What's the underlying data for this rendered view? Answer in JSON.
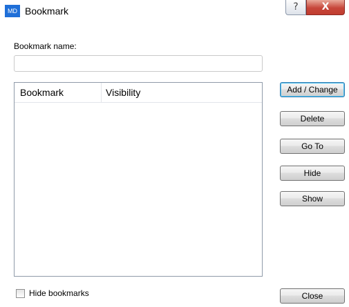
{
  "window": {
    "app_icon_text": "MD",
    "title": "Bookmark",
    "help_glyph": "?",
    "close_glyph": "X"
  },
  "form": {
    "name_label": "Bookmark name:",
    "name_value": "",
    "name_placeholder": ""
  },
  "list": {
    "columns": [
      "Bookmark",
      "Visibility"
    ],
    "rows": []
  },
  "buttons": {
    "add_change": "Add / Change",
    "delete": "Delete",
    "go_to": "Go To",
    "hide": "Hide",
    "show": "Show",
    "close": "Close"
  },
  "options": {
    "hide_bookmarks_label": "Hide bookmarks",
    "hide_bookmarks_checked": false
  },
  "colors": {
    "app_icon": "#1f6fd8",
    "close_button": "#c7463a",
    "default_button_border": "#3c7fb1"
  }
}
